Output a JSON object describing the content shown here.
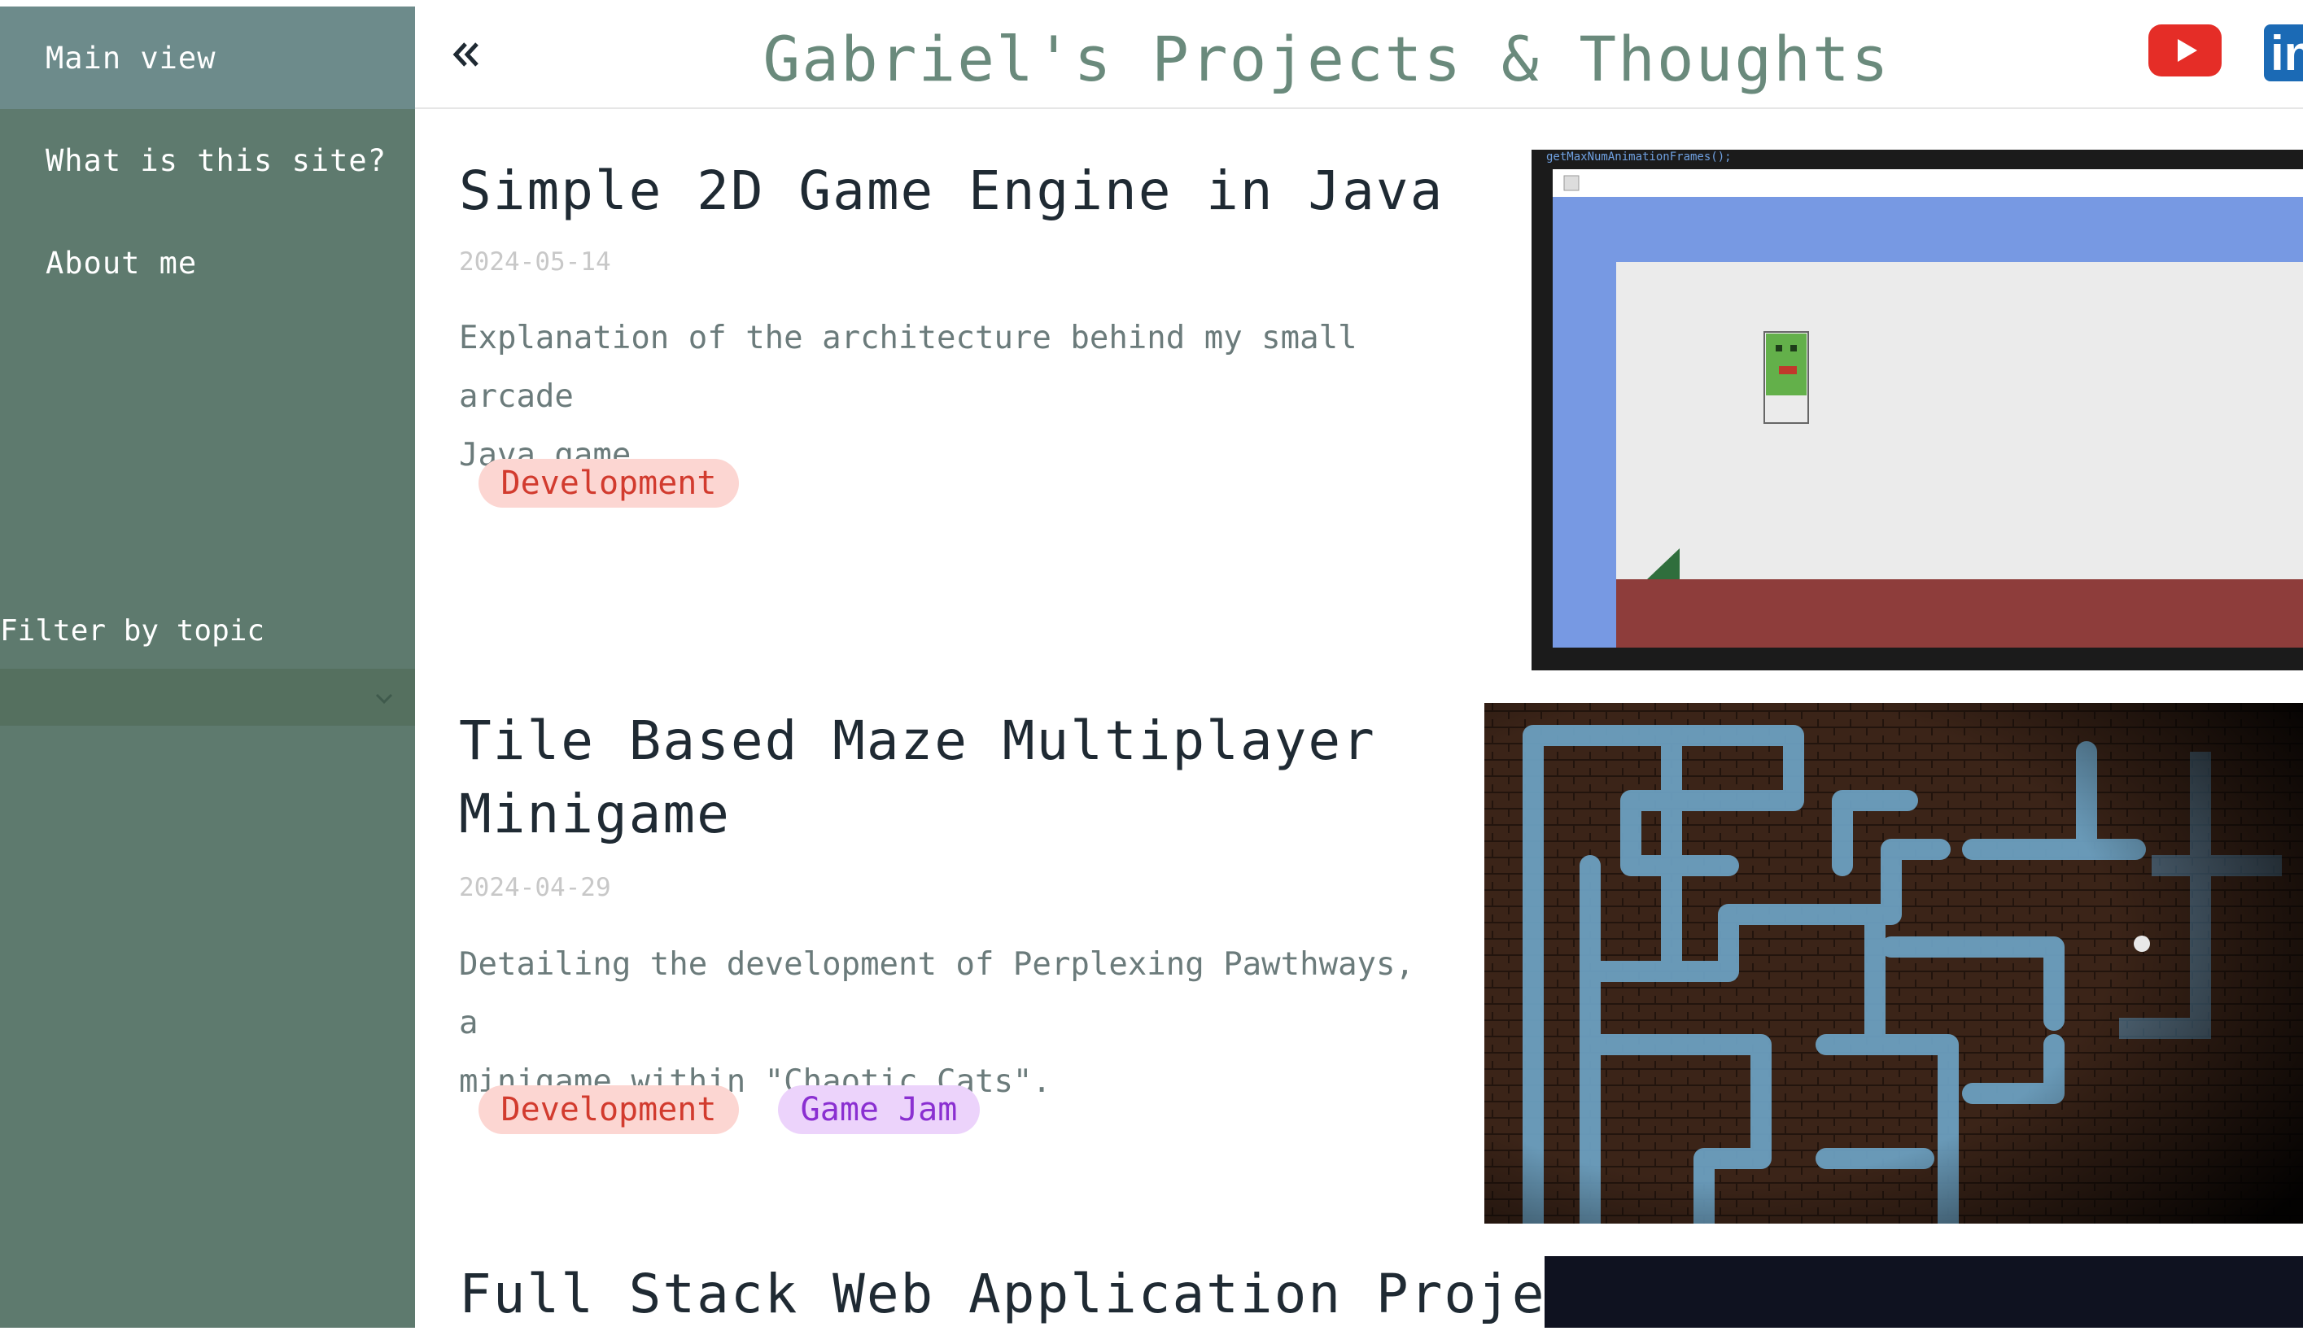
{
  "sidebar": {
    "items": [
      {
        "label": "Main view"
      },
      {
        "label": "What is this site?"
      },
      {
        "label": "About me"
      }
    ],
    "filter_label": "Filter by topic",
    "filter_value": ""
  },
  "header": {
    "title": "Gabriel's Projects & Thoughts",
    "collapse_icon": "double-chevron-left-icon",
    "social": [
      "youtube-icon",
      "linkedin-icon"
    ]
  },
  "posts": [
    {
      "title": "Simple 2D Game Engine in Java",
      "date": "2024-05-14",
      "desc_lines": [
        "Explanation of the architecture behind my small arcade",
        "Java game."
      ],
      "tags": [
        "Development"
      ],
      "thumb_code_text": "getMaxNumAnimationFrames();"
    },
    {
      "title_lines": [
        "Tile Based Maze Multiplayer",
        "Minigame"
      ],
      "date": "2024-04-29",
      "desc_lines": [
        "Detailing the development of Perplexing Pawthways, a",
        "minigame within \"Chaotic Cats\"."
      ],
      "tags": [
        "Development",
        "Game Jam"
      ]
    },
    {
      "title": "Full Stack Web Application Project"
    }
  ],
  "colors": {
    "sidebar": "#5e7a6e",
    "title": "#6a8a7c",
    "tag_dev_bg": "#fcd6d2",
    "tag_dev_text": "#d23b2e",
    "tag_jam_bg": "#ecd3fb",
    "tag_jam_text": "#8a2fd1"
  }
}
